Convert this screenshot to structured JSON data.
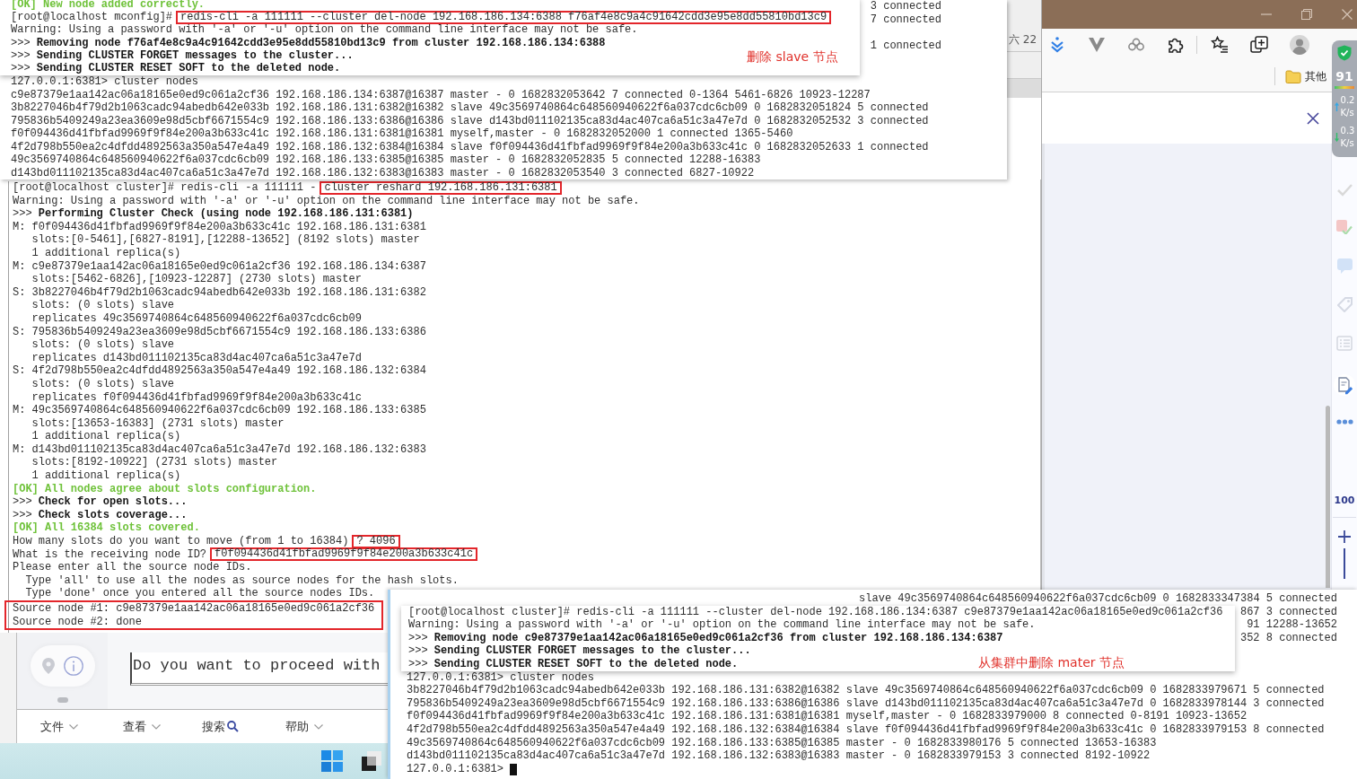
{
  "top_capture": {
    "peeks": [
      "3 connected",
      "7 connected",
      "1 connected"
    ],
    "popup": {
      "lines": [
        {
          "kind": "ok",
          "text": "[OK] New node added correctly."
        },
        {
          "kind": "marked",
          "text": "[root@localhost mconfig]#",
          "marked": "redis-cli -a 111111 --cluster del-node 192.168.186.134:6388 f76af4e8c9a4c91642cdd3e95e8dd55810bd13c9"
        },
        {
          "kind": "text",
          "text": "Warning: Using a password with '-a' or '-u' option on the command line interface may not be safe."
        },
        {
          "kind": "text",
          "text": ">>> **Removing node f76af4e8c9a4c91642cdd3e95e8dd55810bd13c9 from cluster 192.168.186.134:6388**"
        },
        {
          "kind": "text",
          "text": ">>> **Sending CLUSTER FORGET messages to the cluster...**"
        },
        {
          "kind": "text",
          "text": ">>> **Sending CLUSTER RESET SOFT to the deleted node.**"
        }
      ],
      "note": "删除 slave 节点"
    },
    "lines": [
      {
        "kind": "text",
        "text": "127.0.0.1:6381> cluster nodes"
      },
      {
        "kind": "text",
        "text": "c9e87379e1aa142ac06a18165e0ed9c061a2cf36 192.168.186.134:6387@16387 master - 0 1682832053642 7 connected 0-1364 5461-6826 10923-12287"
      },
      {
        "kind": "text",
        "text": "3b8227046b4f79d2b1063cadc94abedb642e033b 192.168.186.131:6382@16382 slave 49c3569740864c648560940622f6a037cdc6cb09 0 1682832051824 5 connected"
      },
      {
        "kind": "text",
        "text": "795836b5409249a23ea3609e98d5cbf6671554c9 192.168.186.133:6386@16386 slave d143bd011102135ca83d4ac407ca6a51c3a47e7d 0 1682832052532 3 connected"
      },
      {
        "kind": "text",
        "text": "f0f094436d41fbfad9969f9f84e200a3b633c41c 192.168.186.131:6381@16381 myself,master - 0 1682832052000 1 connected 1365-5460"
      },
      {
        "kind": "text",
        "text": "4f2d798b550ea2c4dfdd4892563a350a547e4a49 192.168.186.132:6384@16384 slave f0f094436d41fbfad9969f9f84e200a3b633c41c 0 1682832052633 1 connected"
      },
      {
        "kind": "text",
        "text": "49c3569740864c648560940622f6a037cdc6cb09 192.168.186.133:6385@16385 master - 0 1682832052835 5 connected 12288-16383"
      },
      {
        "kind": "text",
        "text": "d143bd011102135ca83d4ac407ca6a51c3a47e7d 192.168.186.132:6383@16383 master - 0 1682832053540 3 connected 6827-10922"
      }
    ]
  },
  "background_window": {
    "date": "六 22"
  },
  "browser": {
    "bookmark": "其他",
    "monitor": {
      "score": "91",
      "rates": [
        {
          "kind": "up",
          "value": "0.2",
          "unit": "K/s"
        },
        {
          "kind": "down",
          "value": "0.3",
          "unit": "K/s"
        }
      ]
    },
    "zoom_level": "100"
  },
  "main_terminal": {
    "lines": [
      {
        "kind": "marked",
        "text": "[root@localhost cluster]# redis-cli -a 111111 -",
        "marked": "cluster reshard 192.168.186.131:6381"
      },
      {
        "kind": "text",
        "text": "Warning: Using a password with '-a' or '-u' option on the command line interface may not be safe."
      },
      {
        "kind": "text",
        "text": ">>> **Performing Cluster Check (using node 192.168.186.131:6381)**"
      },
      {
        "kind": "text",
        "text": "M: f0f094436d41fbfad9969f9f84e200a3b633c41c 192.168.186.131:6381"
      },
      {
        "kind": "text",
        "text": "   slots:[0-5461],[6827-8191],[12288-13652] (8192 slots) master"
      },
      {
        "kind": "text",
        "text": "   1 additional replica(s)"
      },
      {
        "kind": "text",
        "text": "M: c9e87379e1aa142ac06a18165e0ed9c061a2cf36 192.168.186.134:6387"
      },
      {
        "kind": "text",
        "text": "   slots:[5462-6826],[10923-12287] (2730 slots) master"
      },
      {
        "kind": "text",
        "text": "S: 3b8227046b4f79d2b1063cadc94abedb642e033b 192.168.186.131:6382"
      },
      {
        "kind": "text",
        "text": "   slots: (0 slots) slave"
      },
      {
        "kind": "text",
        "text": "   replicates 49c3569740864c648560940622f6a037cdc6cb09"
      },
      {
        "kind": "text",
        "text": "S: 795836b5409249a23ea3609e98d5cbf6671554c9 192.168.186.133:6386"
      },
      {
        "kind": "text",
        "text": "   slots: (0 slots) slave"
      },
      {
        "kind": "text",
        "text": "   replicates d143bd011102135ca83d4ac407ca6a51c3a47e7d"
      },
      {
        "kind": "text",
        "text": "S: 4f2d798b550ea2c4dfdd4892563a350a547e4a49 192.168.186.132:6384"
      },
      {
        "kind": "text",
        "text": "   slots: (0 slots) slave"
      },
      {
        "kind": "text",
        "text": "   replicates f0f094436d41fbfad9969f9f84e200a3b633c41c"
      },
      {
        "kind": "text",
        "text": "M: 49c3569740864c648560940622f6a037cdc6cb09 192.168.186.133:6385"
      },
      {
        "kind": "text",
        "text": "   slots:[13653-16383] (2731 slots) master"
      },
      {
        "kind": "text",
        "text": "   1 additional replica(s)"
      },
      {
        "kind": "text",
        "text": "M: d143bd011102135ca83d4ac407ca6a51c3a47e7d 192.168.186.132:6383"
      },
      {
        "kind": "text",
        "text": "   slots:[8192-10922] (2731 slots) master"
      },
      {
        "kind": "text",
        "text": "   1 additional replica(s)"
      },
      {
        "kind": "ok",
        "text": "[OK] All nodes agree about slots configuration."
      },
      {
        "kind": "text",
        "text": ">>> **Check for open slots...**"
      },
      {
        "kind": "text",
        "text": ">>> **Check slots coverage...**"
      },
      {
        "kind": "ok",
        "text": "[OK] All 16384 slots covered."
      },
      {
        "kind": "marked",
        "text": "How many slots do you want to move (from 1 to 16384)",
        "marked": "? 4096"
      },
      {
        "kind": "marked",
        "text": "What is the receiving node ID?",
        "marked": "f0f094436d41fbfad9969f9f84e200a3b633c41c"
      },
      {
        "kind": "text",
        "text": "Please enter all the source node IDs."
      },
      {
        "kind": "text",
        "text": "  Type 'all' to use all the nodes as source nodes for the hash slots."
      },
      {
        "kind": "text",
        "text": "  Type 'done' once you entered all the source nodes IDs."
      },
      {
        "kind": "framed",
        "lines": [
          "Source node #1: c9e87379e1aa142ac06a18165e0ed9c061a2cf36",
          "Source node #2: done"
        ]
      }
    ]
  },
  "app_fragment": {
    "field_text": "Do you want to proceed with",
    "menu": [
      {
        "kind": "dropdown",
        "label": "文件"
      },
      {
        "kind": "dropdown",
        "label": "查看"
      },
      {
        "kind": "search",
        "label": "搜索"
      },
      {
        "kind": "dropdown",
        "label": "帮助"
      }
    ]
  },
  "bottom_capture": {
    "peeks": [
      "slave 49c3569740864c648560940622f6a037cdc6cb09 0 1682833347384 5 connected",
      "867 3 connected",
      "91 12288-13652",
      "352 8 connected"
    ],
    "popup": {
      "lines": [
        {
          "kind": "text",
          "text": "[root@localhost cluster]# redis-cli -a 111111 --cluster del-node 192.168.186.134:6387 c9e87379e1aa142ac06a18165e0ed9c061a2cf36"
        },
        {
          "kind": "text",
          "text": "Warning: Using a password with '-a' or '-u' option on the command line interface may not be safe."
        },
        {
          "kind": "text",
          "text": ">>> **Removing node c9e87379e1aa142ac06a18165e0ed9c061a2cf36 from cluster 192.168.186.134:6387**"
        },
        {
          "kind": "text",
          "text": ">>> **Sending CLUSTER FORGET messages to the cluster...**"
        },
        {
          "kind": "text",
          "text": ">>> **Sending CLUSTER RESET SOFT to the deleted node.**"
        }
      ],
      "note": "从集群中删除 mater 节点"
    },
    "lines": [
      {
        "kind": "text",
        "text": "127.0.0.1:6381> cluster nodes"
      },
      {
        "kind": "text",
        "text": "3b8227046b4f79d2b1063cadc94abedb642e033b 192.168.186.131:6382@16382 slave 49c3569740864c648560940622f6a037cdc6cb09 0 1682833979671 5 connected"
      },
      {
        "kind": "text",
        "text": "795836b5409249a23ea3609e98d5cbf6671554c9 192.168.186.133:6386@16386 slave d143bd011102135ca83d4ac407ca6a51c3a47e7d 0 1682833978144 3 connected"
      },
      {
        "kind": "text",
        "text": "f0f094436d41fbfad9969f9f84e200a3b633c41c 192.168.186.131:6381@16381 myself,master - 0 1682833979000 8 connected 0-8191 10923-13652"
      },
      {
        "kind": "text",
        "text": "4f2d798b550ea2c4dfdd4892563a350a547e4a49 192.168.186.132:6384@16384 slave f0f094436d41fbfad9969f9f84e200a3b633c41c 0 1682833979153 8 connected"
      },
      {
        "kind": "text",
        "text": "49c3569740864c648560940622f6a037cdc6cb09 192.168.186.133:6385@16385 master - 0 1682833980176 5 connected 13653-16383"
      },
      {
        "kind": "text",
        "text": "d143bd011102135ca83d4ac407ca6a51c3a47e7d 192.168.186.132:6383@16383 master - 0 1682833979153 3 connected 8192-10922"
      },
      {
        "kind": "cursor",
        "text": "127.0.0.1:6381>"
      }
    ]
  }
}
